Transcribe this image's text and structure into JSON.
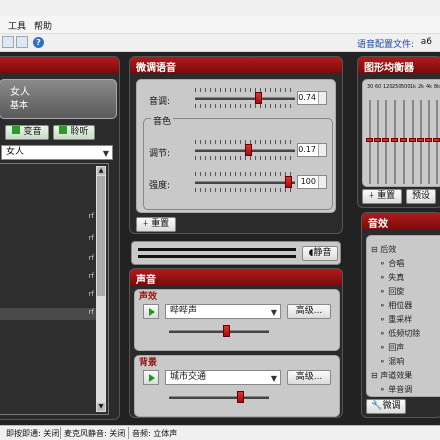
{
  "menu": {
    "tools": "工具",
    "help": "帮助"
  },
  "toolbar": {
    "profile_label": "语音配置文件:",
    "profile_value": "a6"
  },
  "voice_panel": {
    "selected_name": "女人",
    "selected_sub": "基本",
    "morph_btn": "变音",
    "listen_btn": "聆听",
    "dropdown_value": "女人",
    "list_items": [
      {
        "label": ""
      },
      {
        "label": ""
      },
      {
        "label": ""
      },
      {
        "label": ""
      },
      {
        "label": ""
      },
      {
        "label": ""
      }
    ]
  },
  "tune": {
    "title": "微调语音",
    "pitch_label": "音调:",
    "pitch_value": "0.74",
    "timbre_group": "音色",
    "tone_label": "调节:",
    "tone_value": "0.17",
    "strength_label": "强度:",
    "strength_value": "100",
    "reset_btn": "重置",
    "mute_btn": "静音"
  },
  "eq": {
    "title": "图形均衡器",
    "band_labels": [
      "30",
      "60",
      "120",
      "250",
      "500",
      "1k",
      "2k",
      "4k",
      "8k",
      "16k"
    ],
    "reset_btn": "重置",
    "preset_btn": "预设"
  },
  "effects": {
    "title": "音效",
    "tree_root": "后效",
    "tree_items": [
      "合唱",
      "失真",
      "回旋",
      "相位器",
      "重采样",
      "低频切除",
      "回声",
      "混响"
    ],
    "tree_root2": "声道效果",
    "tree_items2": [
      "单音调"
    ],
    "tune_btn": "微调"
  },
  "sound": {
    "title": "声音",
    "effects_label": "声效",
    "effects_value": "哔哔声",
    "effects_adv": "高级...",
    "background_label": "背景",
    "background_value": "城市交通",
    "background_adv": "高级..."
  },
  "status": {
    "ptt": "即按即通: 关闭",
    "mic_mute": "麦克风静音: 关闭",
    "audio": "音频: 立体声"
  }
}
